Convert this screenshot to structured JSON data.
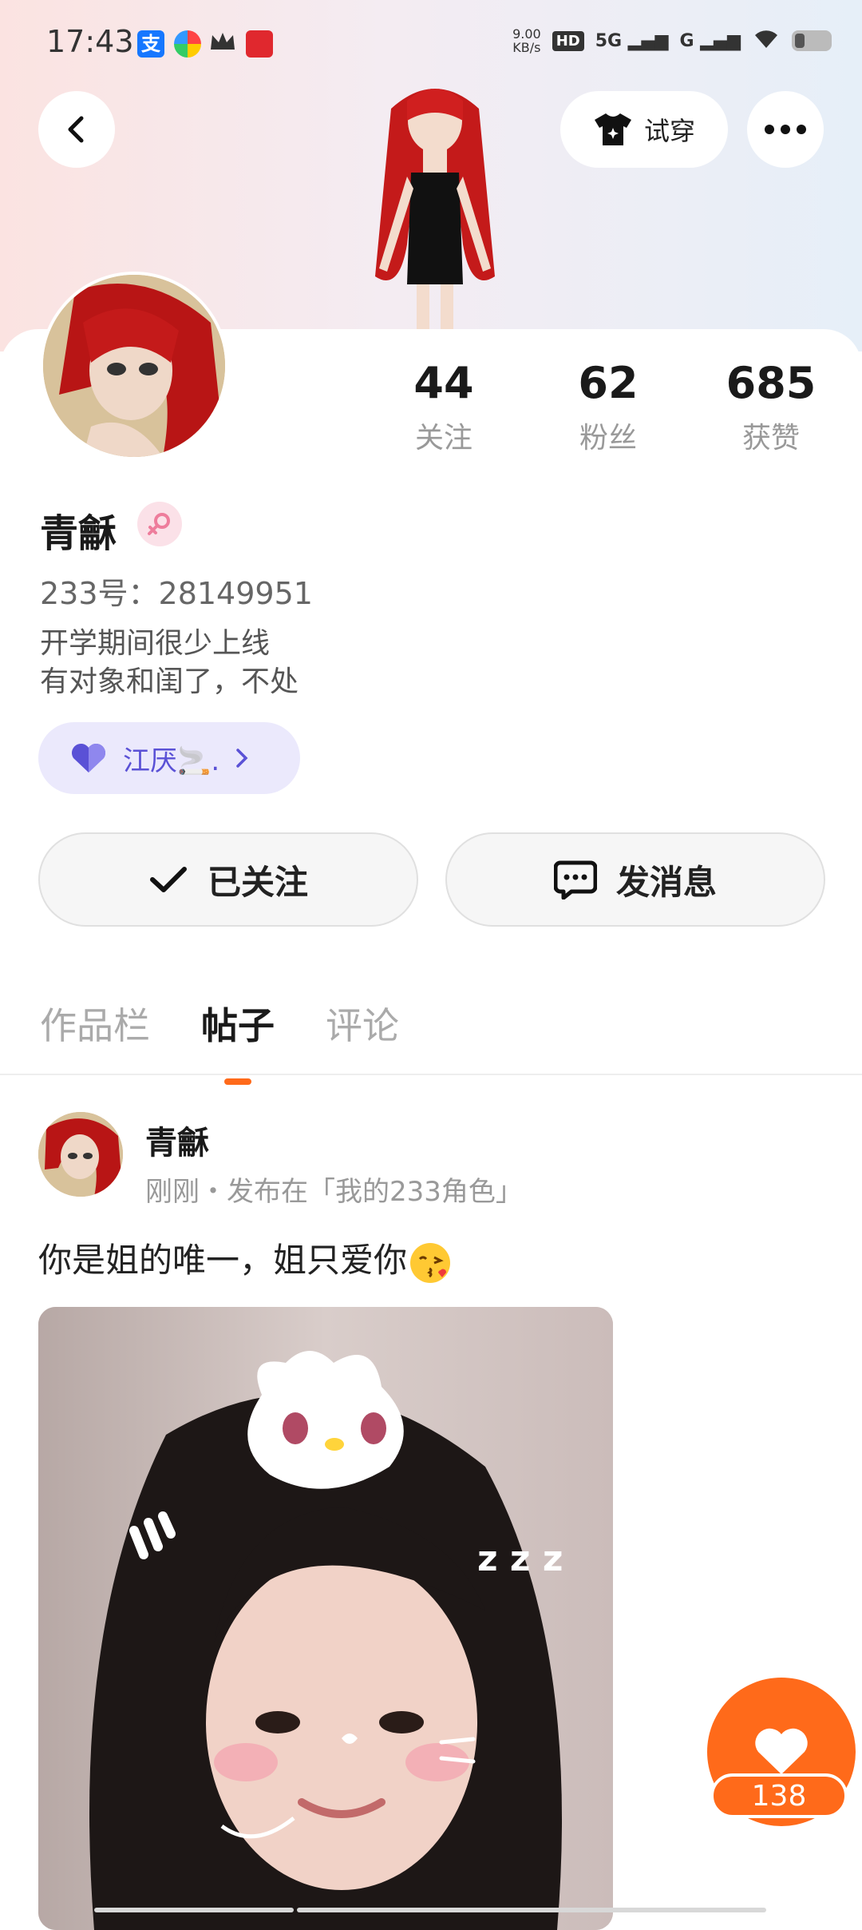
{
  "status_bar": {
    "time": "17:43",
    "net_speed_value": "9.00",
    "net_speed_unit": "KB/s",
    "hd": "HD",
    "sim1": "5G",
    "sim2": "G"
  },
  "header": {
    "back_icon": "chevron-left-icon",
    "try_on_label": "试穿",
    "more_icon": "more-dots-icon"
  },
  "profile": {
    "name": "青龢",
    "gender_icon": "female-icon",
    "uid": "233号：28149951",
    "bio_line1": "开学期间很少上线",
    "bio_line2": "有对象和闺了，不处",
    "cp_name": "江厌🚬.",
    "stats": [
      {
        "value": "44",
        "label": "关注"
      },
      {
        "value": "62",
        "label": "粉丝"
      },
      {
        "value": "685",
        "label": "获赞"
      }
    ]
  },
  "actions": {
    "followed_label": "已关注",
    "message_label": "发消息"
  },
  "tabs": [
    {
      "label": "作品栏",
      "active": false
    },
    {
      "label": "帖子",
      "active": true
    },
    {
      "label": "评论",
      "active": false
    }
  ],
  "post": {
    "author": "青龢",
    "meta": "刚刚・发布在「我的233角色」",
    "text": "你是姐的唯一，姐只爱你",
    "like_count": "138"
  },
  "colors": {
    "accent_orange": "#ff6a1a",
    "cp_purple": "#5a51d6",
    "female_pink": "#ee7d9c"
  }
}
